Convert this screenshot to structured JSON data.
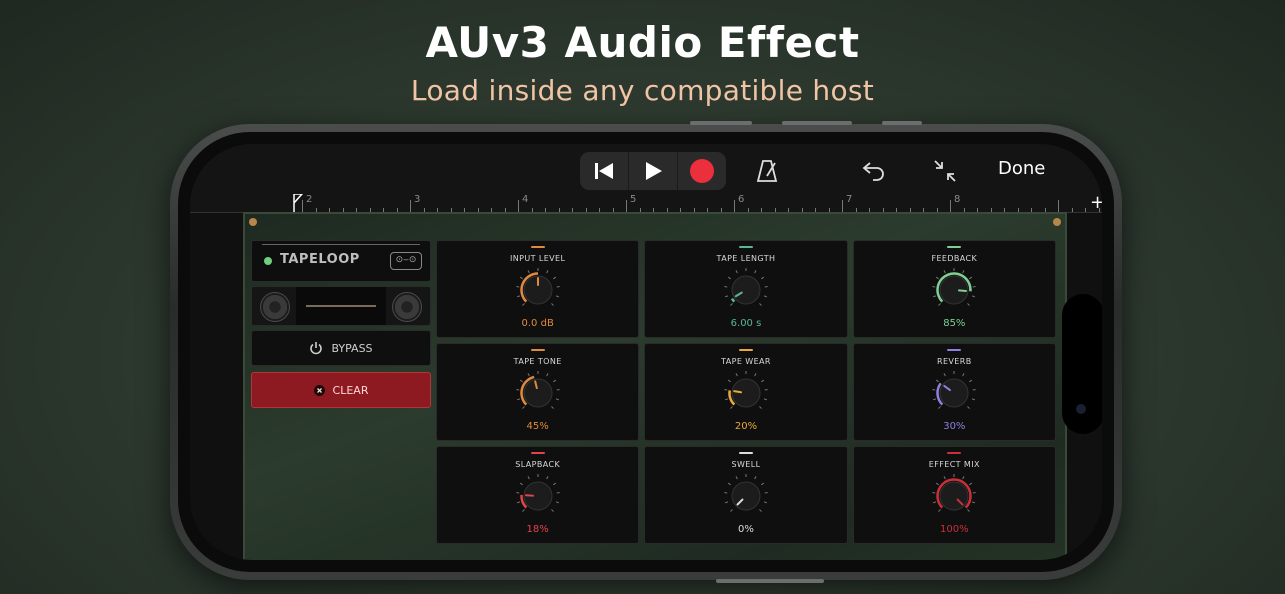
{
  "promo": {
    "title": "AUv3 Audio Effect",
    "subtitle": "Load inside any compatible host"
  },
  "host": {
    "done_label": "Done",
    "ruler_marks": [
      "2",
      "3",
      "4",
      "5",
      "6",
      "7",
      "8"
    ],
    "add_label": "+"
  },
  "plugin": {
    "logo": "TAPELOOP",
    "bypass_label": "BYPASS",
    "clear_label": "CLEAR",
    "controls": [
      {
        "label": "INPUT LEVEL",
        "value": "0.0 dB",
        "color": "#e08a3c",
        "level": 0.5
      },
      {
        "label": "TAPE LENGTH",
        "value": "6.00 s",
        "color": "#5bb59a",
        "level": 0.05
      },
      {
        "label": "FEEDBACK",
        "value": "85%",
        "color": "#7fcf95",
        "level": 0.85
      },
      {
        "label": "TAPE TONE",
        "value": "45%",
        "color": "#e08a3c",
        "level": 0.45
      },
      {
        "label": "TAPE WEAR",
        "value": "20%",
        "color": "#e8a83c",
        "level": 0.2
      },
      {
        "label": "REVERB",
        "value": "30%",
        "color": "#8f7fe0",
        "level": 0.3
      },
      {
        "label": "SLAPBACK",
        "value": "18%",
        "color": "#e0454a",
        "level": 0.18
      },
      {
        "label": "SWELL",
        "value": "0%",
        "color": "#dddddd",
        "level": 0.0
      },
      {
        "label": "EFFECT MIX",
        "value": "100%",
        "color": "#c9303a",
        "level": 1.0
      }
    ]
  }
}
